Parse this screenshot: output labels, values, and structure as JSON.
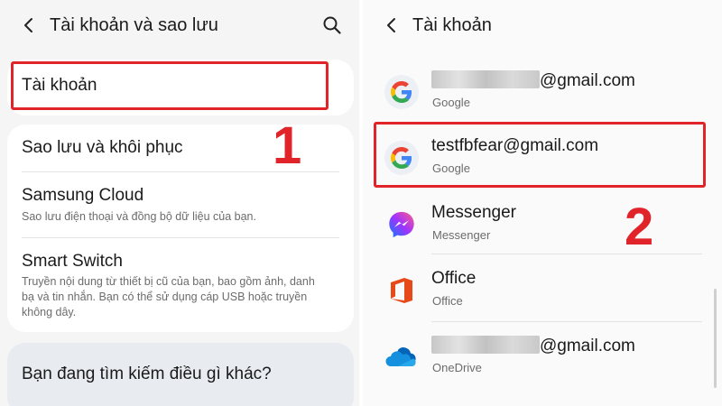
{
  "left": {
    "header_title": "Tài khoản và sao lưu",
    "account_item": "Tài khoản",
    "items": [
      {
        "title": "Sao lưu và khôi phục",
        "desc": ""
      },
      {
        "title": "Samsung Cloud",
        "desc": "Sao lưu điện thoại và đồng bộ dữ liệu của bạn."
      },
      {
        "title": "Smart Switch",
        "desc": "Truyền nội dung từ thiết bị cũ của bạn, bao gồm ảnh, danh bạ và tin nhắn. Bạn có thể sử dụng cáp USB hoặc truyền không dây."
      }
    ],
    "suggest_title": "Bạn đang tìm kiếm điều gì khác?",
    "step_label": "1"
  },
  "right": {
    "header_title": "Tài khoản",
    "accounts": [
      {
        "main": "@gmail.com",
        "sub": "Google",
        "icon": "google-icon"
      },
      {
        "main": "testfbfear@gmail.com",
        "sub": "Google",
        "icon": "google-icon"
      },
      {
        "main": "Messenger",
        "sub": "Messenger",
        "icon": "messenger-icon"
      },
      {
        "main": "Office",
        "sub": "Office",
        "icon": "office-icon"
      },
      {
        "main": "@gmail.com",
        "sub": "OneDrive",
        "icon": "onedrive-icon"
      }
    ],
    "step_label": "2"
  },
  "colors": {
    "highlight": "#e0242a",
    "google_blue": "#4285F4",
    "google_red": "#EA4335",
    "google_yellow": "#FBBC05",
    "google_green": "#34A853",
    "office_orange": "#E64A19",
    "onedrive_blue": "#0F78D4"
  }
}
